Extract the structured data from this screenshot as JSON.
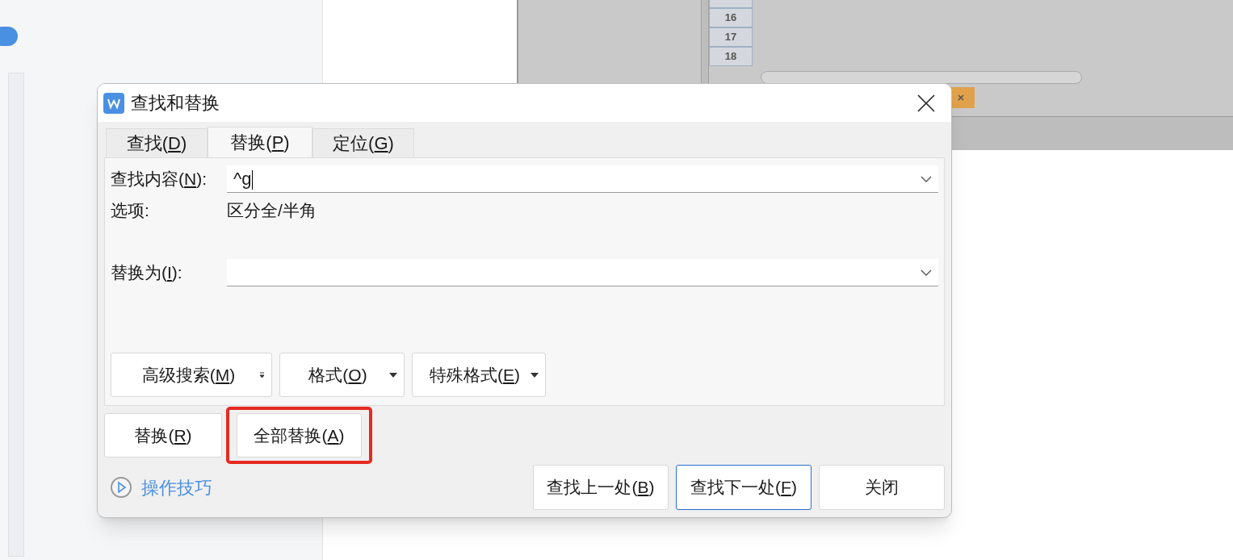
{
  "background": {
    "row_headers": [
      "16",
      "17",
      "18"
    ]
  },
  "dialog": {
    "title": "查找和替换",
    "tabs": [
      {
        "text": "查找(",
        "key": "D",
        "tail": ")",
        "selected": false
      },
      {
        "text": "替换(",
        "key": "P",
        "tail": ")",
        "selected": true
      },
      {
        "text": "定位(",
        "key": "G",
        "tail": ")",
        "selected": false
      }
    ],
    "find": {
      "label": {
        "text": "查找内容(",
        "key": "N",
        "tail": "):"
      },
      "value": "^g"
    },
    "options": {
      "label": "选项:",
      "value": "区分全/半角"
    },
    "replace": {
      "label": {
        "text": "替换为(",
        "key": "I",
        "tail": "):"
      }
    },
    "option_buttons": [
      {
        "text": "高级搜索(",
        "key": "M",
        "tail": ")",
        "kind": "small-arrow"
      },
      {
        "text": "格式(",
        "key": "O",
        "tail": ")",
        "kind": "dropdown"
      },
      {
        "text": "特殊格式(",
        "key": "E",
        "tail": ")",
        "kind": "dropdown"
      }
    ],
    "action_buttons": [
      {
        "text": "替换(",
        "key": "R",
        "tail": ")",
        "highlighted": false
      },
      {
        "text": "全部替换(",
        "key": "A",
        "tail": ")",
        "highlighted": true
      }
    ],
    "tips_link": "操作技巧",
    "nav_buttons": [
      {
        "text": "查找上一处(",
        "key": "B",
        "tail": ")",
        "focused": false
      },
      {
        "text": "查找下一处(",
        "key": "F",
        "tail": ")",
        "focused": true
      },
      {
        "text": "关闭",
        "focused": false
      }
    ]
  }
}
